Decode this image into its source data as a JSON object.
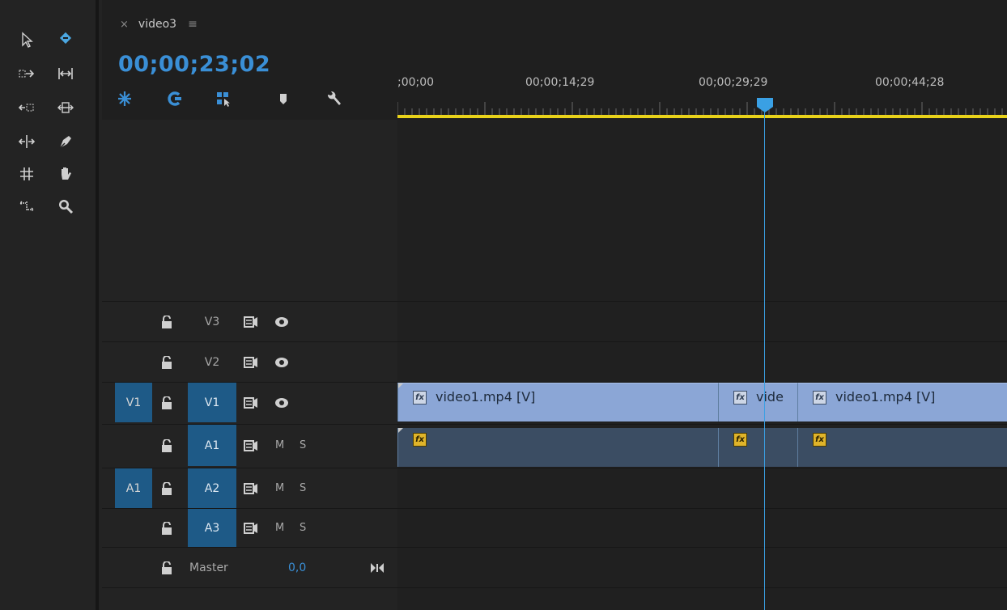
{
  "sequence": {
    "name": "video3",
    "close_glyph": "×",
    "menu_glyph": "≡",
    "timecode": "00;00;23;02"
  },
  "ruler": {
    "labels": [
      ";00;00",
      "00;00;14;29",
      "00;00;29;29",
      "00;00;44;28"
    ],
    "playhead_timecode": "00;00;23;02"
  },
  "tools": [
    {
      "name": "selection-tool",
      "active": false
    },
    {
      "name": "track-select-forward-tool",
      "active": true
    },
    {
      "name": "track-select-backward-tool",
      "active": false
    },
    {
      "name": "ripple-edit-tool",
      "active": false
    },
    {
      "name": "rolling-edit-tool",
      "active": false
    },
    {
      "name": "rate-stretch-tool",
      "active": false
    },
    {
      "name": "razor-tool",
      "active": false
    },
    {
      "name": "pen-tool",
      "active": false
    },
    {
      "name": "slip-tool",
      "active": false
    },
    {
      "name": "hand-tool",
      "active": false
    },
    {
      "name": "slide-tool",
      "active": false
    },
    {
      "name": "zoom-tool",
      "active": false
    }
  ],
  "timeline_controls": [
    "snap-icon",
    "linked-selection-icon",
    "add-edit-icon",
    "add-marker-icon",
    "wrench-icon"
  ],
  "tracks": {
    "video": [
      {
        "source": "",
        "name": "V3",
        "targeted": false
      },
      {
        "source": "",
        "name": "V2",
        "targeted": false
      },
      {
        "source": "V1",
        "name": "V1",
        "targeted": true
      }
    ],
    "audio": [
      {
        "source": "",
        "name": "A1",
        "targeted": true,
        "mute": "M",
        "solo": "S"
      },
      {
        "source": "A1",
        "name": "A2",
        "targeted": true,
        "mute": "M",
        "solo": "S"
      },
      {
        "source": "",
        "name": "A3",
        "targeted": true,
        "mute": "M",
        "solo": "S"
      }
    ],
    "master": {
      "label": "Master",
      "value": "0,0"
    }
  },
  "clips": {
    "video": [
      "video1.mp4 [V]",
      "vide",
      "video1.mp4 [V]"
    ],
    "fx_label": "fx"
  },
  "colors": {
    "accent_blue": "#3a8fd6",
    "target_blue": "#1e5a87",
    "video_clip": "#8ba6d6",
    "audio_clip": "#3b4d63",
    "work_area": "#e8d21a",
    "playhead": "#3aa0e4"
  }
}
